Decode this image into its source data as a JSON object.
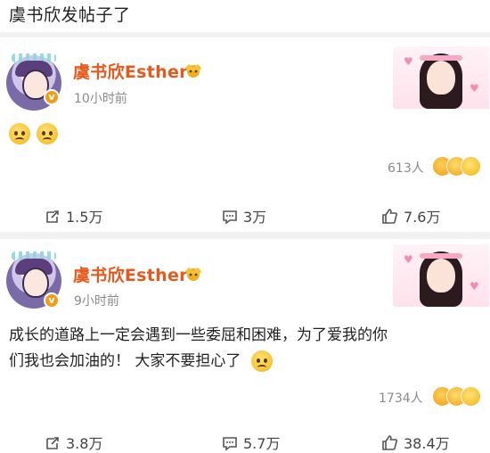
{
  "header": {
    "title": "虞书欣发帖子了"
  },
  "posts": [
    {
      "author": "虞书欣Esther",
      "time": "10小时前",
      "reactions": "613人",
      "repost": "1.5万",
      "comment": "3万",
      "like": "7.6万"
    },
    {
      "author": "虞书欣Esther",
      "time": "9小时前",
      "text_line1": "成长的道路上一定会遇到一些委屈和困难，为了爱我的你",
      "text_line2": "们我也会加油的！ 大家不要担心了",
      "reactions": "1734人",
      "repost": "3.8万",
      "comment": "5.7万",
      "like": "38.4万"
    }
  ],
  "icons": [
    "repost-icon",
    "comment-icon",
    "like-icon",
    "verified-badge-icon",
    "crown-icon",
    "sad-emoji-icon"
  ],
  "colors": {
    "author": "#e8581c",
    "verified": "#f29d1a",
    "meta": "#8a8a8a"
  }
}
